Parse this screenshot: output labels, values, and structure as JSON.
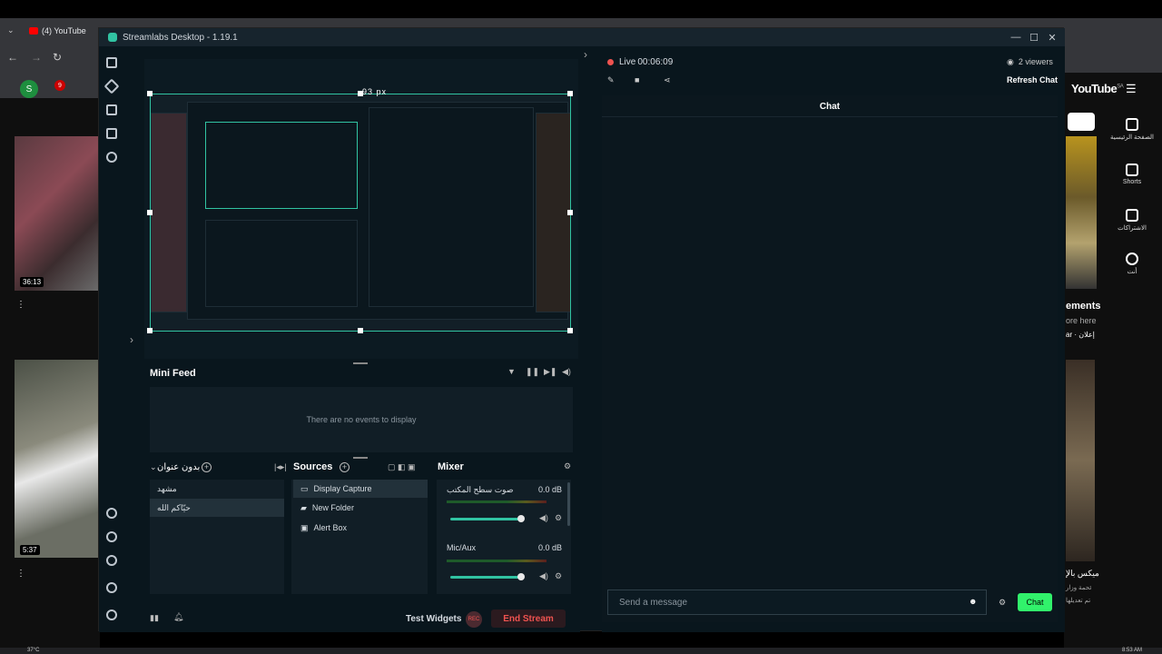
{
  "browser": {
    "tab_label": "(4) YouTube",
    "profile_initial": "S",
    "notif_count": "9",
    "yt_brand": "YouTube",
    "yt_region": "SA"
  },
  "yt_left": {
    "video1_duration": "36:13",
    "video2_duration": "5:37"
  },
  "yt_right": {
    "nav": [
      "الصفحة الرئيسية",
      "Shorts",
      "الاشتراكات",
      "أنت"
    ],
    "promo_title": "ements",
    "promo_line1": "ore here",
    "promo_line2": "ar · إعلان",
    "video_title": "ميكس بالإ",
    "video_sub1": "ئحمة وزار",
    "video_sub2": "تم تعديلها"
  },
  "app": {
    "title": "Streamlabs Desktop - 1.19.1",
    "minimize": "—",
    "maximize": "☐",
    "close": "✕"
  },
  "editor": {
    "size_label": "93 px"
  },
  "mini_feed": {
    "title": "Mini Feed",
    "empty_text": "There are no events to display"
  },
  "scenes": {
    "title": "بدون عنوان",
    "items": [
      "مشهد",
      "حيّاكم الله"
    ]
  },
  "sources": {
    "title": "Sources",
    "items": [
      "Display Capture",
      "New Folder",
      "Alert Box"
    ]
  },
  "mixer": {
    "title": "Mixer",
    "channels": [
      {
        "name": "صوت سطح المكتب",
        "level": "0.0 dB",
        "volume": 0.85
      },
      {
        "name": "Mic/Aux",
        "level": "0.0 dB",
        "volume": 0.85
      }
    ]
  },
  "footer": {
    "test_widgets": "Test Widgets",
    "rec": "REC",
    "end_stream": "End Stream"
  },
  "chat": {
    "live_label": "Live",
    "live_time": "00:06:09",
    "viewers": "2 viewers",
    "refresh": "Refresh Chat",
    "title": "Chat",
    "placeholder": "Send a message",
    "send_button": "Chat"
  },
  "taskbar": {
    "temp": "37°C",
    "time": "8:53 AM"
  },
  "colors": {
    "accent": "#31c3a2",
    "live": "#ef5350",
    "chat_green": "#31f26b"
  }
}
